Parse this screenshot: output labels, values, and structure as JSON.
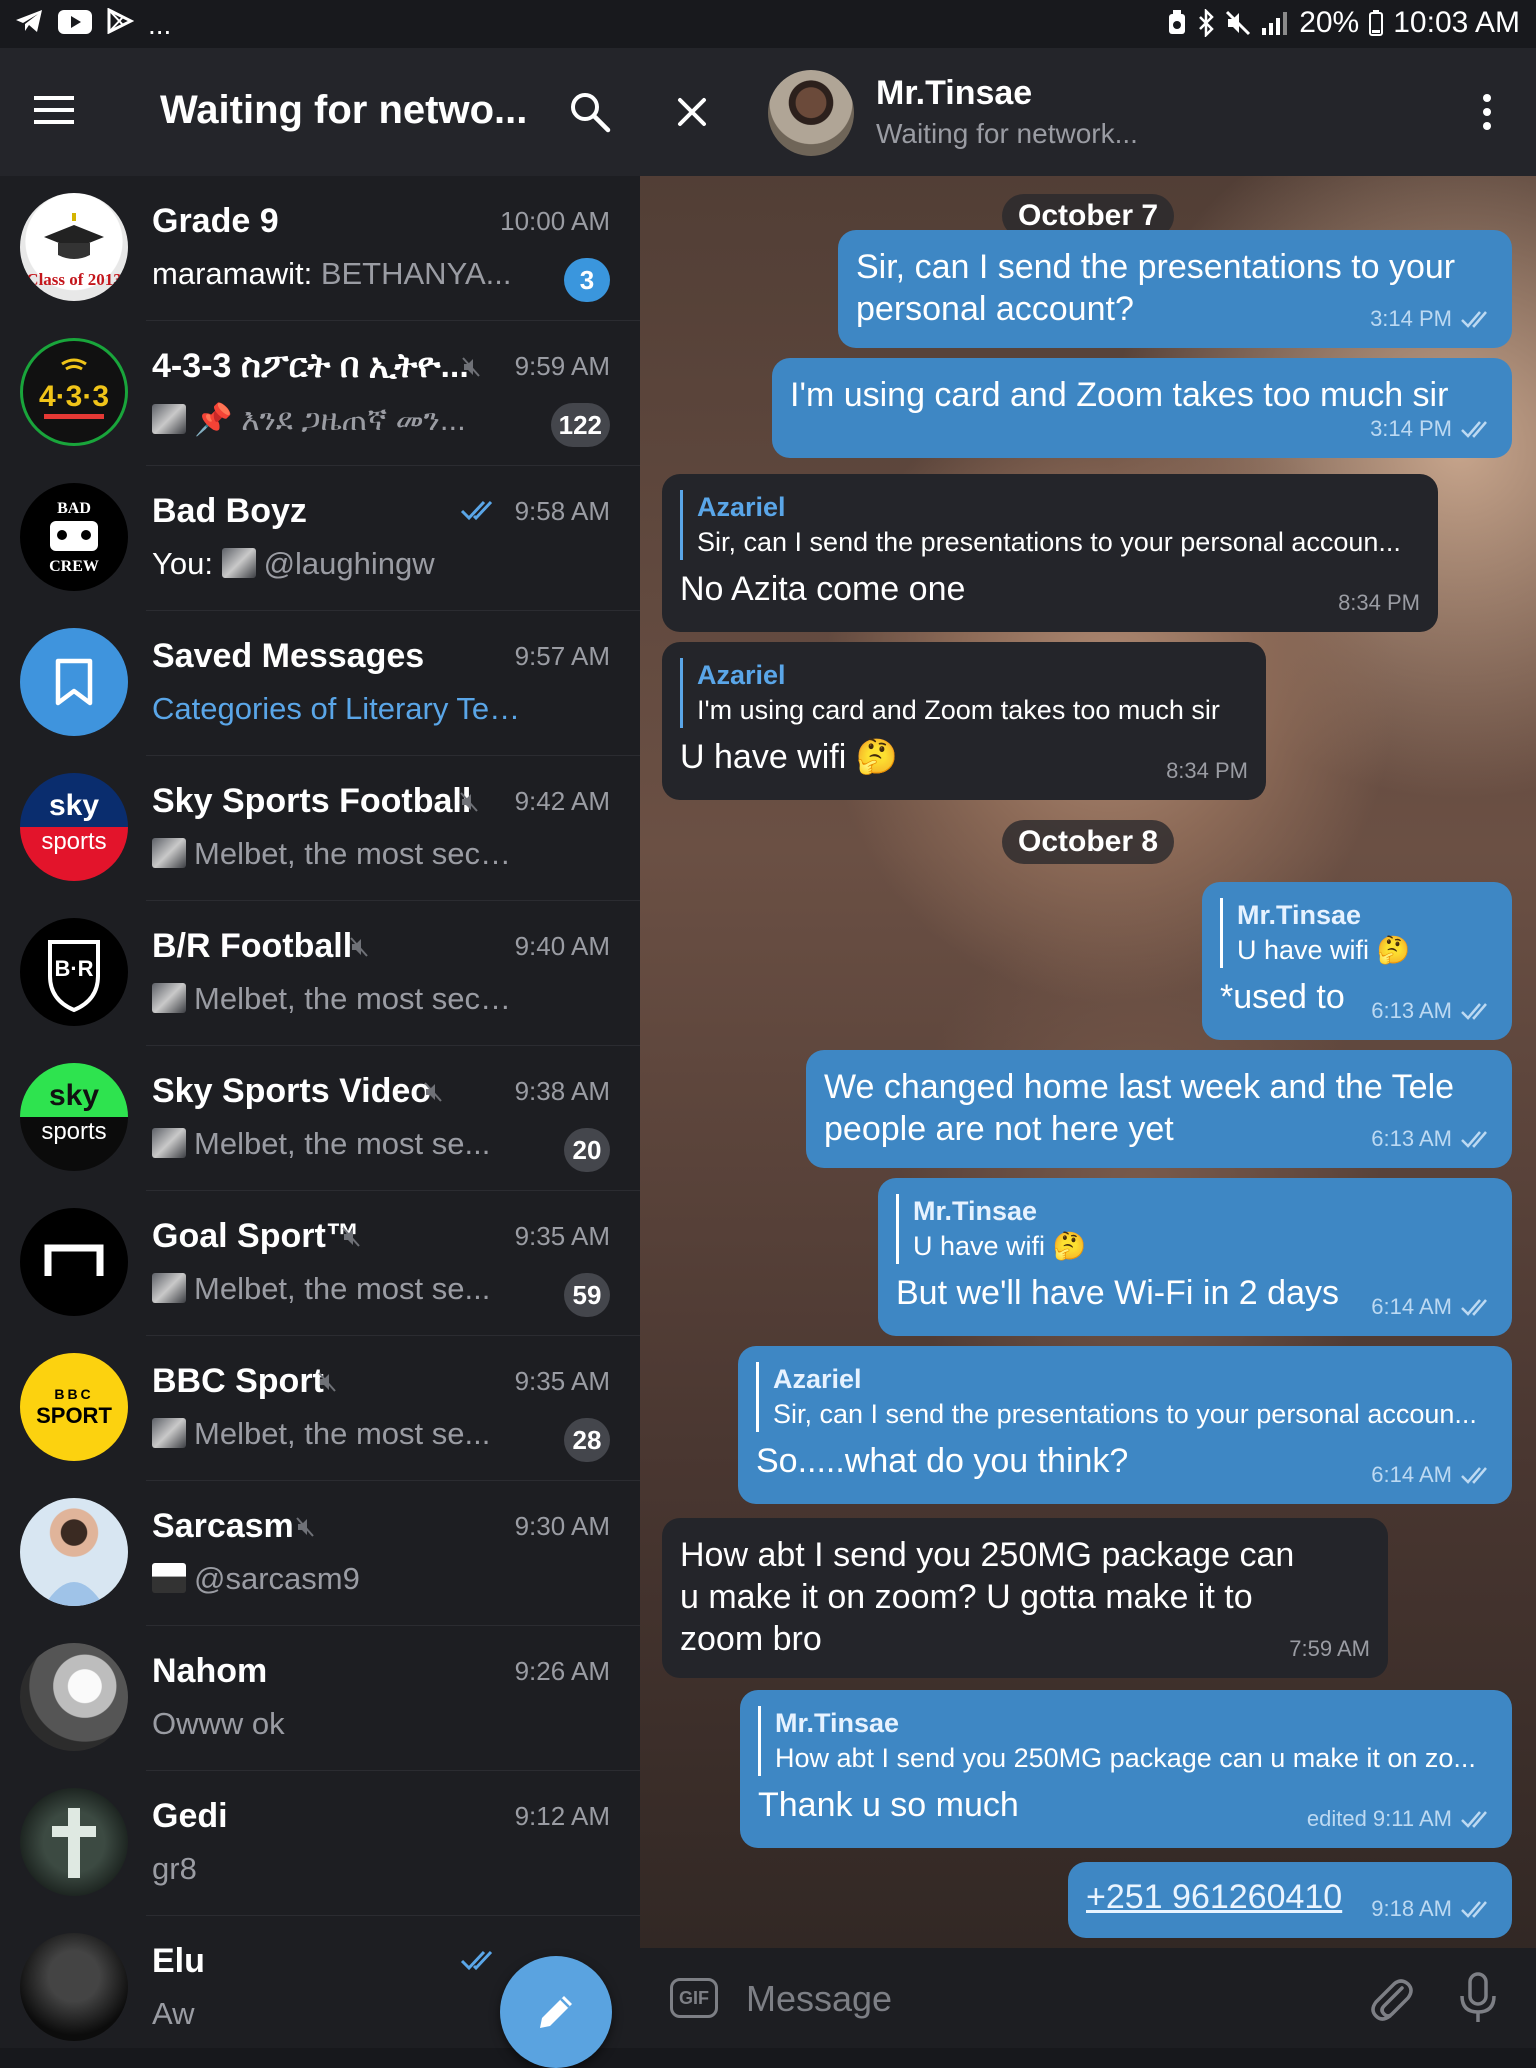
{
  "status_bar": {
    "battery": "20%",
    "time": "10:03 AM",
    "overflow": "..."
  },
  "left_header": {
    "title": "Waiting for netwo..."
  },
  "chats": [
    {
      "name": "Grade 9",
      "time": "10:00 AM",
      "sender": "maramawit:",
      "preview": "BETHANYA...",
      "badge": "3",
      "badge_color": "blue",
      "muted": false
    },
    {
      "name": "4-3-3 ስፖርት በ ኢትዮ...",
      "time": "9:59 AM",
      "preview": "📌 እንደ ጋዜጠኛ መን...",
      "badge": "122",
      "muted": true,
      "thumb": true
    },
    {
      "name": "Bad Boyz",
      "time": "9:58 AM",
      "sender": "You:",
      "preview": "@laughingw",
      "read": true,
      "thumb": true
    },
    {
      "name": "Saved Messages",
      "time": "9:57 AM",
      "preview": "Categories of Literary Terms...",
      "preview_blue": true
    },
    {
      "name": "Sky Sports Football",
      "time": "9:42 AM",
      "preview": "Melbet, the most secure...",
      "muted": true,
      "thumb": true
    },
    {
      "name": "B/R Football",
      "time": "9:40 AM",
      "preview": "Melbet, the most secure...",
      "muted": true,
      "thumb": true
    },
    {
      "name": "Sky Sports Video",
      "time": "9:38 AM",
      "preview": "Melbet, the most se...",
      "badge": "20",
      "muted": true,
      "thumb": true
    },
    {
      "name": "Goal Sport™",
      "time": "9:35 AM",
      "preview": "Melbet, the most se...",
      "badge": "59",
      "muted": true,
      "thumb": true
    },
    {
      "name": "BBC Sport",
      "time": "9:35 AM",
      "preview": "Melbet, the most se...",
      "badge": "28",
      "muted": true,
      "thumb": true
    },
    {
      "name": "Sarcasm",
      "time": "9:30 AM",
      "preview": "@sarcasm9",
      "muted": true,
      "thumb": true
    },
    {
      "name": "Nahom",
      "time": "9:26 AM",
      "preview": "Owww ok"
    },
    {
      "name": "Gedi",
      "time": "9:12 AM",
      "preview": "gr8"
    },
    {
      "name": "Elu",
      "time": "",
      "preview": "Aw",
      "read": true
    }
  ],
  "avatars": {
    "grade9": "Class of 2013",
    "f433": "4·3·3",
    "badboyz_top": "BAD",
    "badboyz_bottom": "CREW",
    "sky1_top": "sky",
    "sky1_bottom": "sports",
    "br": "B·R",
    "sky2_top": "sky",
    "sky2_bottom": "sports",
    "bbc_top": "BBC",
    "bbc_bottom": "SPORT"
  },
  "conversation": {
    "contact_name": "Mr.Tinsae",
    "contact_status": "Waiting for network...",
    "date1": "October 7",
    "date2": "October 8",
    "messages": [
      {
        "dir": "out",
        "text": "Sir, can I send the presentations to your personal account?",
        "time": "3:14 PM"
      },
      {
        "dir": "out",
        "text": "I'm using card and Zoom takes too much sir",
        "time": "3:14 PM"
      },
      {
        "dir": "in",
        "reply_name": "Azariel",
        "reply_text": "Sir, can I send the presentations to your personal accoun...",
        "text": "No Azita come one",
        "time": "8:34 PM"
      },
      {
        "dir": "in",
        "reply_name": "Azariel",
        "reply_text": "I'm using card and Zoom takes too much sir",
        "text": "U have wifi 🤔",
        "time": "8:34 PM"
      },
      {
        "dir": "out",
        "reply_name": "Mr.Tinsae",
        "reply_text": "U have wifi 🤔",
        "text": "*used to",
        "time": "6:13 AM"
      },
      {
        "dir": "out",
        "text": "We changed home last week and the Tele people are not here yet",
        "time": "6:13 AM"
      },
      {
        "dir": "out",
        "reply_name": "Mr.Tinsae",
        "reply_text": "U have wifi 🤔",
        "text": "But we'll have Wi-Fi in 2 days",
        "time": "6:14 AM"
      },
      {
        "dir": "out",
        "reply_name": "Azariel",
        "reply_text": "Sir, can I send the presentations to your personal accoun...",
        "text": "So.....what do you think?",
        "time": "6:14 AM"
      },
      {
        "dir": "in",
        "text": "How abt I send you 250MG package can u make it on zoom? U gotta make it to zoom bro",
        "time": "7:59 AM"
      },
      {
        "dir": "out",
        "reply_name": "Mr.Tinsae",
        "reply_text": "How abt I send you 250MG package can u make it on zo...",
        "text": "Thank u so much",
        "time": "edited 9:11 AM"
      },
      {
        "dir": "out",
        "text": "+251 961260410",
        "time": "9:18 AM"
      }
    ]
  },
  "composer": {
    "placeholder": "Message",
    "gif_label": "GIF"
  },
  "colors": {
    "outgoing_bubble": "#3e87c4",
    "incoming_bubble": "#24252a",
    "accent": "#5aa6e8",
    "unread_badge": "#3a96dd"
  }
}
